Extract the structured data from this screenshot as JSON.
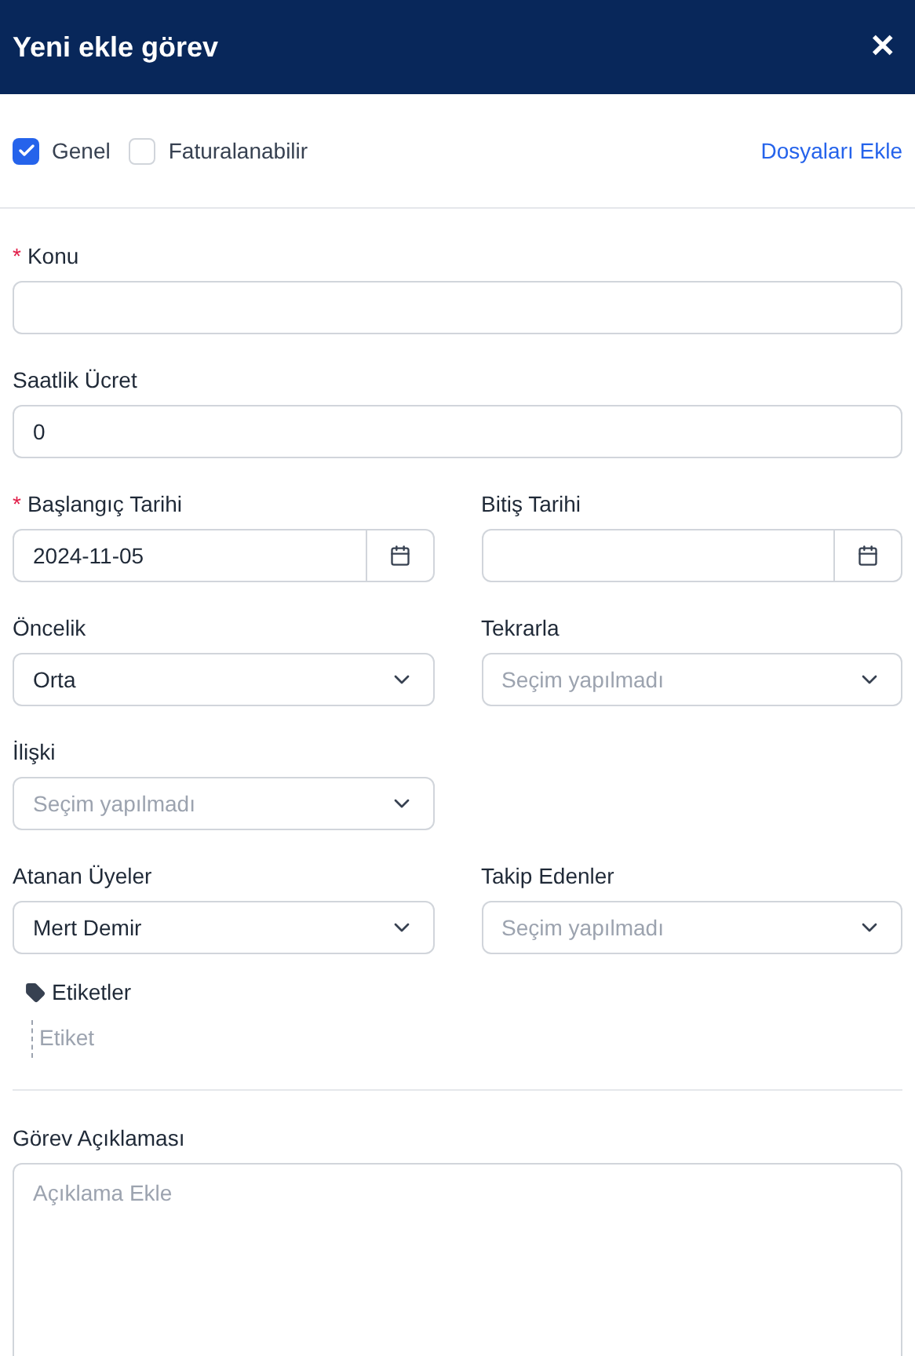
{
  "header": {
    "title": "Yeni ekle görev",
    "close": "✕"
  },
  "options": [
    {
      "label": "Genel",
      "checked": true
    },
    {
      "label": "Faturalanabilir",
      "checked": false
    }
  ],
  "attach_link": "Dosyaları Ekle",
  "rows": [
    [
      {
        "kind": "text",
        "label": "Konu",
        "mark": "*"
      }
    ],
    [
      {
        "kind": "text",
        "label": "Saatlik Ücret",
        "value": "0"
      }
    ],
    [
      {
        "kind": "date",
        "label": "Başlangıç Tarihi",
        "mark": "*",
        "value": "2024-11-05"
      },
      {
        "kind": "date",
        "label": "Bitiş Tarihi"
      }
    ],
    [
      {
        "kind": "select",
        "label": "Öncelik",
        "value": "Orta"
      },
      {
        "kind": "select",
        "label": "Tekrarla",
        "placeholder": "Seçim yapılmadı"
      }
    ],
    [
      {
        "kind": "select",
        "label": "İlişki",
        "placeholder": "Seçim yapılmadı"
      }
    ],
    [
      {
        "kind": "select",
        "label": "Atanan Üyeler",
        "value": "Mert Demir"
      },
      {
        "kind": "select",
        "label": "Takip Edenler",
        "placeholder": "Seçim yapılmadı"
      }
    ]
  ],
  "tags": {
    "label": "Etiketler",
    "placeholder": "Etiket"
  },
  "description": {
    "label": "Görev Açıklaması",
    "placeholder": "Açıklama Ekle"
  }
}
